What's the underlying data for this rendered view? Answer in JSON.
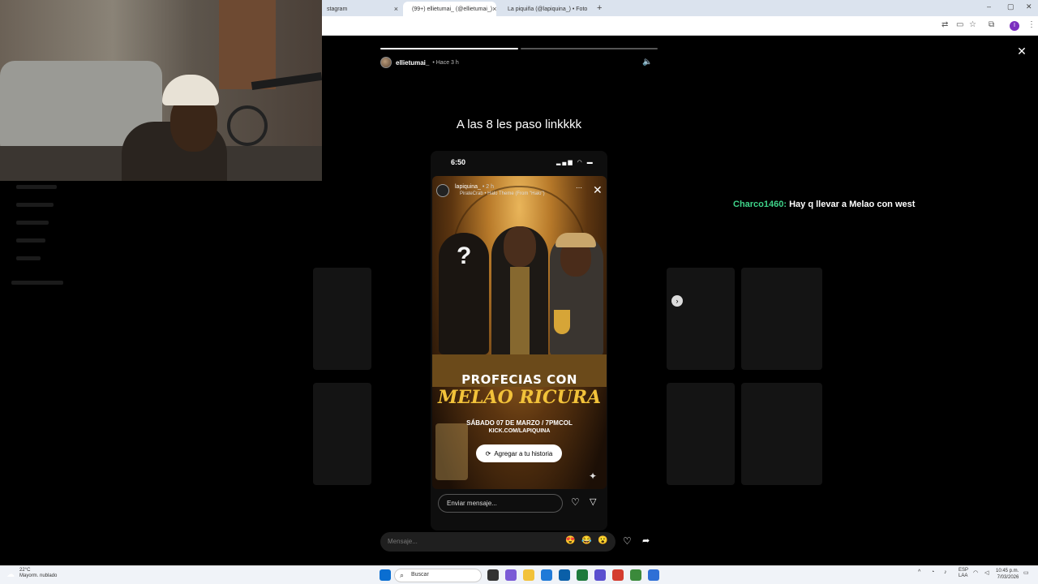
{
  "browser": {
    "tabs": [
      {
        "label": "stagram",
        "active": false
      },
      {
        "label": "(99+) ellietumai_ (@ellietumai_)",
        "active": true
      },
      {
        "label": "La piquiña (@lapiquina_) • Foto",
        "active": false
      }
    ],
    "new_tab": "+",
    "close_tab": "×"
  },
  "story": {
    "username": "ellietumai_",
    "time": "• Hace 3 h",
    "progress": [
      1.0,
      0.0
    ],
    "caption": "A las 8 les paso linkkkk",
    "phone_time": "6:50",
    "inner": {
      "username": "lapiquina_",
      "time": "• 2 h",
      "song": "PirateCrab • Halo Theme (From \"Halo\")",
      "poster_line1": "PROFECIAS CON",
      "poster_line2": "MELAO RICURA",
      "poster_date": "SÁBADO 07 DE MARZO / 7PMCOL",
      "poster_link": "KICK.COM/LAPIQUINA",
      "poster_question": "?",
      "add_story": "Agregar a tu historia",
      "message_placeholder": "Enviar mensaje..."
    },
    "reply_placeholder": "Mensaje...",
    "emojis": [
      "😍",
      "😂",
      "😮"
    ]
  },
  "chat": {
    "user": "Charco1460:",
    "message": "Hay q llevar a Melao con west"
  },
  "taskbar": {
    "temp": "22°C",
    "weather": "Mayorm. nublado",
    "search": "Buscar",
    "lang1": "ESP",
    "lang2": "LAA",
    "time": "10:45 p.m.",
    "date": "7/03/2026"
  }
}
